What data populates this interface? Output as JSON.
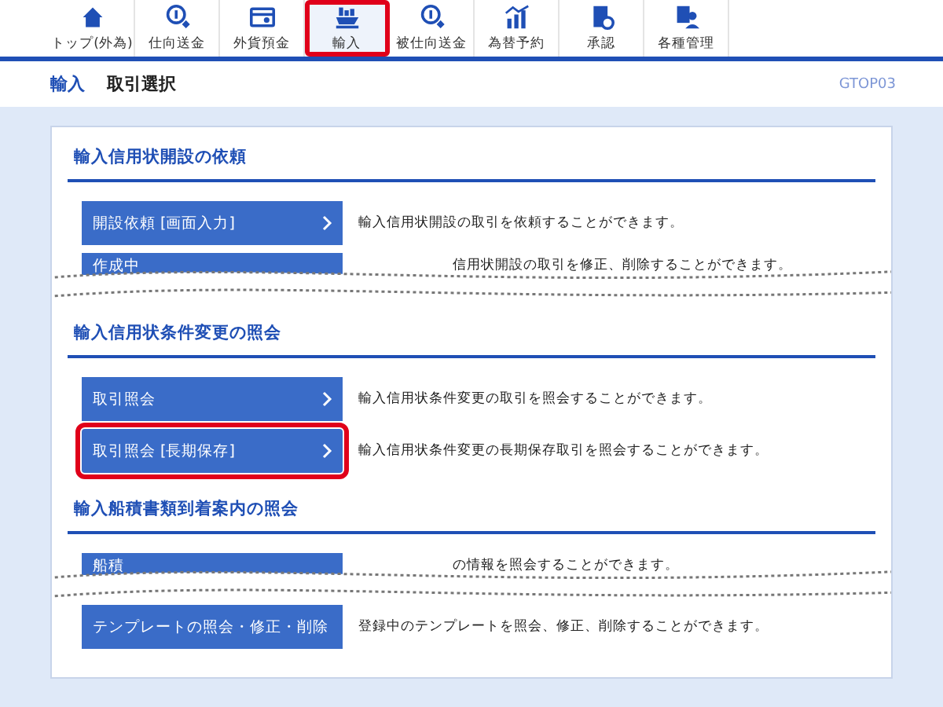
{
  "nav": [
    {
      "label": "トップ(外為)",
      "selected": false
    },
    {
      "label": "仕向送金",
      "selected": false
    },
    {
      "label": "外貨預金",
      "selected": false
    },
    {
      "label": "輸入",
      "selected": true
    },
    {
      "label": "被仕向送金",
      "selected": false
    },
    {
      "label": "為替予約",
      "selected": false
    },
    {
      "label": "承認",
      "selected": false
    },
    {
      "label": "各種管理",
      "selected": false
    }
  ],
  "breadcrumb": {
    "section": "輸入",
    "page": "取引選択",
    "screen_id": "GTOP03"
  },
  "sections": [
    {
      "title": "輸入信用状開設の依頼",
      "rows": [
        {
          "kind": "full",
          "button": "開設依頼 [画面入力]",
          "description": "輸入信用状開設の取引を依頼することができます。",
          "highlighted": false
        },
        {
          "kind": "torn",
          "button": "作成中",
          "description": "信用状開設の取引を修正、削除することができます。",
          "highlighted": false
        }
      ]
    },
    {
      "title": "輸入信用状条件変更の照会",
      "rows": [
        {
          "kind": "full",
          "button": "取引照会",
          "description": "輸入信用状条件変更の取引を照会することができます。",
          "highlighted": false
        },
        {
          "kind": "full",
          "button": "取引照会 [長期保存]",
          "description": "輸入信用状条件変更の長期保存取引を照会することができます。",
          "highlighted": true
        }
      ]
    },
    {
      "title": "輸入船積書類到着案内の照会",
      "rows": [
        {
          "kind": "torn",
          "button": "船積",
          "description": "の情報を照会することができます。",
          "highlighted": false
        },
        {
          "kind": "full",
          "button": "テンプレートの照会・修正・削除",
          "description": "登録中のテンプレートを照会、修正、削除することができます。",
          "highlighted": false
        }
      ]
    }
  ]
}
